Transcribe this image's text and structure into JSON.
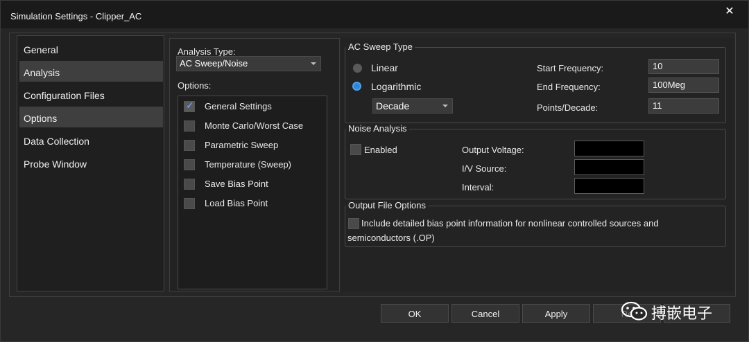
{
  "window": {
    "title": "Simulation Settings - Clipper_AC",
    "close_glyph": "✕"
  },
  "nav": {
    "items": [
      {
        "label": "General",
        "selected": false
      },
      {
        "label": "Analysis",
        "selected": true
      },
      {
        "label": "Configuration Files",
        "selected": false
      },
      {
        "label": "Options",
        "selected": true
      },
      {
        "label": "Data Collection",
        "selected": false
      },
      {
        "label": "Probe Window",
        "selected": false
      }
    ]
  },
  "analysis": {
    "type_label": "Analysis Type:",
    "type_value": "AC Sweep/Noise",
    "options_label": "Options:",
    "options": [
      {
        "label": "General Settings",
        "checked": true
      },
      {
        "label": "Monte Carlo/Worst Case",
        "checked": false
      },
      {
        "label": "Parametric Sweep",
        "checked": false
      },
      {
        "label": "Temperature (Sweep)",
        "checked": false
      },
      {
        "label": "Save Bias Point",
        "checked": false
      },
      {
        "label": "Load Bias Point",
        "checked": false
      }
    ]
  },
  "ac_sweep": {
    "group_title": "AC Sweep Type",
    "linear_label": "Linear",
    "log_label": "Logarithmic",
    "selected": "Logarithmic",
    "decade_value": "Decade",
    "start_label": "Start Frequency:",
    "start_value": "10",
    "end_label": "End Frequency:",
    "end_value": "100Meg",
    "points_label": "Points/Decade:",
    "points_value": "11"
  },
  "noise": {
    "group_title": "Noise Analysis",
    "enabled_label": "Enabled",
    "output_voltage_label": "Output Voltage:",
    "iv_source_label": "I/V Source:",
    "interval_label": "Interval:"
  },
  "output_file": {
    "group_title": "Output File Options",
    "line1": "Include detailed bias point information for nonlinear controlled sources and",
    "line2": "semiconductors (.OP)"
  },
  "buttons": {
    "ok": "OK",
    "cancel": "Cancel",
    "apply": "Apply",
    "reset": "Re"
  },
  "watermark": {
    "text": "搏嵌电子"
  },
  "colors": {
    "accent": "#2f86d6",
    "check": "#7aa7ff",
    "background": "#262626"
  }
}
